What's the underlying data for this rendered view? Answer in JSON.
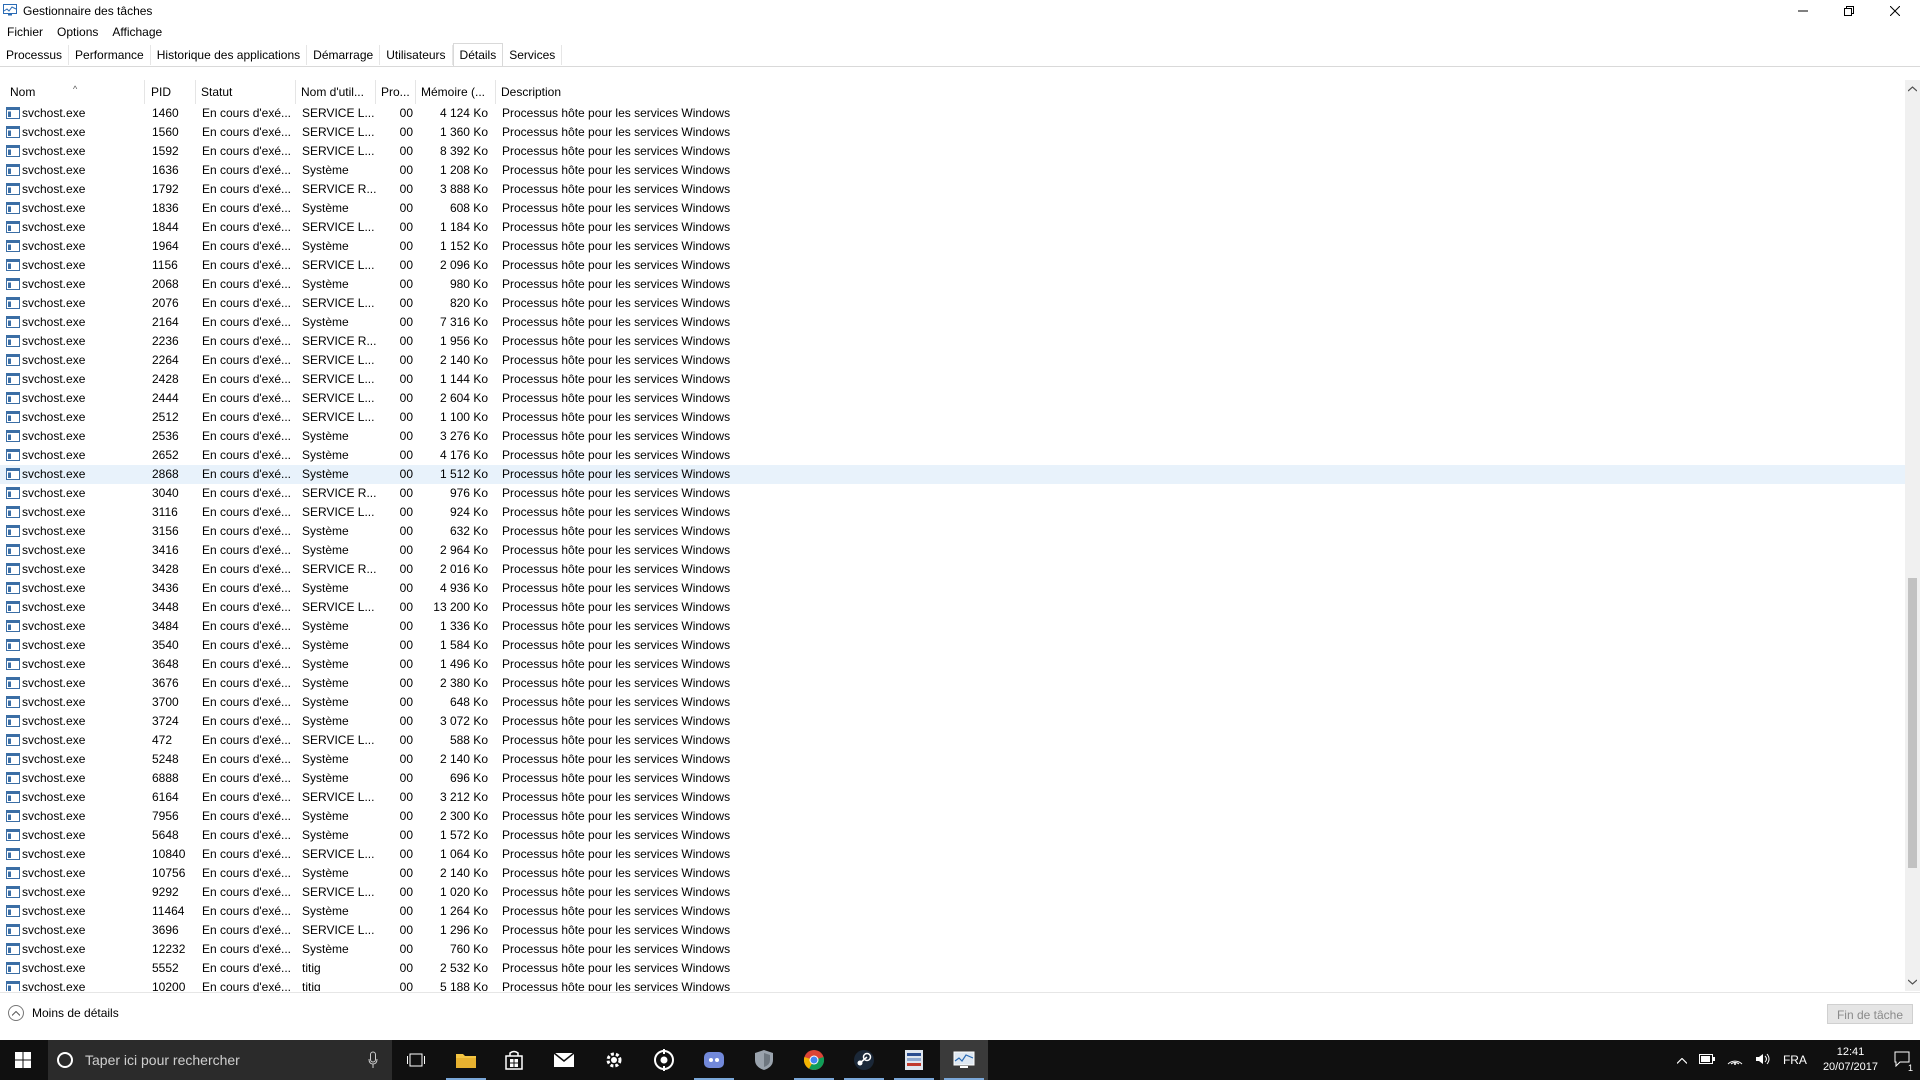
{
  "window": {
    "title": "Gestionnaire des tâches"
  },
  "menu": [
    "Fichier",
    "Options",
    "Affichage"
  ],
  "tabs": [
    {
      "label": "Processus",
      "active": false
    },
    {
      "label": "Performance",
      "active": false
    },
    {
      "label": "Historique des applications",
      "active": false
    },
    {
      "label": "Démarrage",
      "active": false
    },
    {
      "label": "Utilisateurs",
      "active": false
    },
    {
      "label": "Détails",
      "active": true
    },
    {
      "label": "Services",
      "active": false
    }
  ],
  "columns": {
    "name": "Nom",
    "pid": "PID",
    "status": "Statut",
    "user": "Nom d'util...",
    "cpu": "Pro...",
    "memory": "Mémoire (...",
    "description": "Description"
  },
  "selected_pid": "2868",
  "rows": [
    {
      "name": "svchost.exe",
      "pid": "1460",
      "status": "En cours d'exé...",
      "user": "SERVICE L...",
      "cpu": "00",
      "mem": "4 124 Ko",
      "desc": "Processus hôte pour les services Windows"
    },
    {
      "name": "svchost.exe",
      "pid": "1560",
      "status": "En cours d'exé...",
      "user": "SERVICE L...",
      "cpu": "00",
      "mem": "1 360 Ko",
      "desc": "Processus hôte pour les services Windows"
    },
    {
      "name": "svchost.exe",
      "pid": "1592",
      "status": "En cours d'exé...",
      "user": "SERVICE L...",
      "cpu": "00",
      "mem": "8 392 Ko",
      "desc": "Processus hôte pour les services Windows"
    },
    {
      "name": "svchost.exe",
      "pid": "1636",
      "status": "En cours d'exé...",
      "user": "Système",
      "cpu": "00",
      "mem": "1 208 Ko",
      "desc": "Processus hôte pour les services Windows"
    },
    {
      "name": "svchost.exe",
      "pid": "1792",
      "status": "En cours d'exé...",
      "user": "SERVICE R...",
      "cpu": "00",
      "mem": "3 888 Ko",
      "desc": "Processus hôte pour les services Windows"
    },
    {
      "name": "svchost.exe",
      "pid": "1836",
      "status": "En cours d'exé...",
      "user": "Système",
      "cpu": "00",
      "mem": "608 Ko",
      "desc": "Processus hôte pour les services Windows"
    },
    {
      "name": "svchost.exe",
      "pid": "1844",
      "status": "En cours d'exé...",
      "user": "SERVICE L...",
      "cpu": "00",
      "mem": "1 184 Ko",
      "desc": "Processus hôte pour les services Windows"
    },
    {
      "name": "svchost.exe",
      "pid": "1964",
      "status": "En cours d'exé...",
      "user": "Système",
      "cpu": "00",
      "mem": "1 152 Ko",
      "desc": "Processus hôte pour les services Windows"
    },
    {
      "name": "svchost.exe",
      "pid": "1156",
      "status": "En cours d'exé...",
      "user": "SERVICE L...",
      "cpu": "00",
      "mem": "2 096 Ko",
      "desc": "Processus hôte pour les services Windows"
    },
    {
      "name": "svchost.exe",
      "pid": "2068",
      "status": "En cours d'exé...",
      "user": "Système",
      "cpu": "00",
      "mem": "980 Ko",
      "desc": "Processus hôte pour les services Windows"
    },
    {
      "name": "svchost.exe",
      "pid": "2076",
      "status": "En cours d'exé...",
      "user": "SERVICE L...",
      "cpu": "00",
      "mem": "820 Ko",
      "desc": "Processus hôte pour les services Windows"
    },
    {
      "name": "svchost.exe",
      "pid": "2164",
      "status": "En cours d'exé...",
      "user": "Système",
      "cpu": "00",
      "mem": "7 316 Ko",
      "desc": "Processus hôte pour les services Windows"
    },
    {
      "name": "svchost.exe",
      "pid": "2236",
      "status": "En cours d'exé...",
      "user": "SERVICE R...",
      "cpu": "00",
      "mem": "1 956 Ko",
      "desc": "Processus hôte pour les services Windows"
    },
    {
      "name": "svchost.exe",
      "pid": "2264",
      "status": "En cours d'exé...",
      "user": "SERVICE L...",
      "cpu": "00",
      "mem": "2 140 Ko",
      "desc": "Processus hôte pour les services Windows"
    },
    {
      "name": "svchost.exe",
      "pid": "2428",
      "status": "En cours d'exé...",
      "user": "SERVICE L...",
      "cpu": "00",
      "mem": "1 144 Ko",
      "desc": "Processus hôte pour les services Windows"
    },
    {
      "name": "svchost.exe",
      "pid": "2444",
      "status": "En cours d'exé...",
      "user": "SERVICE L...",
      "cpu": "00",
      "mem": "2 604 Ko",
      "desc": "Processus hôte pour les services Windows"
    },
    {
      "name": "svchost.exe",
      "pid": "2512",
      "status": "En cours d'exé...",
      "user": "SERVICE L...",
      "cpu": "00",
      "mem": "1 100 Ko",
      "desc": "Processus hôte pour les services Windows"
    },
    {
      "name": "svchost.exe",
      "pid": "2536",
      "status": "En cours d'exé...",
      "user": "Système",
      "cpu": "00",
      "mem": "3 276 Ko",
      "desc": "Processus hôte pour les services Windows"
    },
    {
      "name": "svchost.exe",
      "pid": "2652",
      "status": "En cours d'exé...",
      "user": "Système",
      "cpu": "00",
      "mem": "4 176 Ko",
      "desc": "Processus hôte pour les services Windows"
    },
    {
      "name": "svchost.exe",
      "pid": "2868",
      "status": "En cours d'exé...",
      "user": "Système",
      "cpu": "00",
      "mem": "1 512 Ko",
      "desc": "Processus hôte pour les services Windows"
    },
    {
      "name": "svchost.exe",
      "pid": "3040",
      "status": "En cours d'exé...",
      "user": "SERVICE R...",
      "cpu": "00",
      "mem": "976 Ko",
      "desc": "Processus hôte pour les services Windows"
    },
    {
      "name": "svchost.exe",
      "pid": "3116",
      "status": "En cours d'exé...",
      "user": "SERVICE L...",
      "cpu": "00",
      "mem": "924 Ko",
      "desc": "Processus hôte pour les services Windows"
    },
    {
      "name": "svchost.exe",
      "pid": "3156",
      "status": "En cours d'exé...",
      "user": "Système",
      "cpu": "00",
      "mem": "632 Ko",
      "desc": "Processus hôte pour les services Windows"
    },
    {
      "name": "svchost.exe",
      "pid": "3416",
      "status": "En cours d'exé...",
      "user": "Système",
      "cpu": "00",
      "mem": "2 964 Ko",
      "desc": "Processus hôte pour les services Windows"
    },
    {
      "name": "svchost.exe",
      "pid": "3428",
      "status": "En cours d'exé...",
      "user": "SERVICE R...",
      "cpu": "00",
      "mem": "2 016 Ko",
      "desc": "Processus hôte pour les services Windows"
    },
    {
      "name": "svchost.exe",
      "pid": "3436",
      "status": "En cours d'exé...",
      "user": "Système",
      "cpu": "00",
      "mem": "4 936 Ko",
      "desc": "Processus hôte pour les services Windows"
    },
    {
      "name": "svchost.exe",
      "pid": "3448",
      "status": "En cours d'exé...",
      "user": "SERVICE L...",
      "cpu": "00",
      "mem": "13 200 Ko",
      "desc": "Processus hôte pour les services Windows"
    },
    {
      "name": "svchost.exe",
      "pid": "3484",
      "status": "En cours d'exé...",
      "user": "Système",
      "cpu": "00",
      "mem": "1 336 Ko",
      "desc": "Processus hôte pour les services Windows"
    },
    {
      "name": "svchost.exe",
      "pid": "3540",
      "status": "En cours d'exé...",
      "user": "Système",
      "cpu": "00",
      "mem": "1 584 Ko",
      "desc": "Processus hôte pour les services Windows"
    },
    {
      "name": "svchost.exe",
      "pid": "3648",
      "status": "En cours d'exé...",
      "user": "Système",
      "cpu": "00",
      "mem": "1 496 Ko",
      "desc": "Processus hôte pour les services Windows"
    },
    {
      "name": "svchost.exe",
      "pid": "3676",
      "status": "En cours d'exé...",
      "user": "Système",
      "cpu": "00",
      "mem": "2 380 Ko",
      "desc": "Processus hôte pour les services Windows"
    },
    {
      "name": "svchost.exe",
      "pid": "3700",
      "status": "En cours d'exé...",
      "user": "Système",
      "cpu": "00",
      "mem": "648 Ko",
      "desc": "Processus hôte pour les services Windows"
    },
    {
      "name": "svchost.exe",
      "pid": "3724",
      "status": "En cours d'exé...",
      "user": "Système",
      "cpu": "00",
      "mem": "3 072 Ko",
      "desc": "Processus hôte pour les services Windows"
    },
    {
      "name": "svchost.exe",
      "pid": "472",
      "status": "En cours d'exé...",
      "user": "SERVICE L...",
      "cpu": "00",
      "mem": "588 Ko",
      "desc": "Processus hôte pour les services Windows"
    },
    {
      "name": "svchost.exe",
      "pid": "5248",
      "status": "En cours d'exé...",
      "user": "Système",
      "cpu": "00",
      "mem": "2 140 Ko",
      "desc": "Processus hôte pour les services Windows"
    },
    {
      "name": "svchost.exe",
      "pid": "6888",
      "status": "En cours d'exé...",
      "user": "Système",
      "cpu": "00",
      "mem": "696 Ko",
      "desc": "Processus hôte pour les services Windows"
    },
    {
      "name": "svchost.exe",
      "pid": "6164",
      "status": "En cours d'exé...",
      "user": "SERVICE L...",
      "cpu": "00",
      "mem": "3 212 Ko",
      "desc": "Processus hôte pour les services Windows"
    },
    {
      "name": "svchost.exe",
      "pid": "7956",
      "status": "En cours d'exé...",
      "user": "Système",
      "cpu": "00",
      "mem": "2 300 Ko",
      "desc": "Processus hôte pour les services Windows"
    },
    {
      "name": "svchost.exe",
      "pid": "5648",
      "status": "En cours d'exé...",
      "user": "Système",
      "cpu": "00",
      "mem": "1 572 Ko",
      "desc": "Processus hôte pour les services Windows"
    },
    {
      "name": "svchost.exe",
      "pid": "10840",
      "status": "En cours d'exé...",
      "user": "SERVICE L...",
      "cpu": "00",
      "mem": "1 064 Ko",
      "desc": "Processus hôte pour les services Windows"
    },
    {
      "name": "svchost.exe",
      "pid": "10756",
      "status": "En cours d'exé...",
      "user": "Système",
      "cpu": "00",
      "mem": "2 140 Ko",
      "desc": "Processus hôte pour les services Windows"
    },
    {
      "name": "svchost.exe",
      "pid": "9292",
      "status": "En cours d'exé...",
      "user": "SERVICE L...",
      "cpu": "00",
      "mem": "1 020 Ko",
      "desc": "Processus hôte pour les services Windows"
    },
    {
      "name": "svchost.exe",
      "pid": "11464",
      "status": "En cours d'exé...",
      "user": "Système",
      "cpu": "00",
      "mem": "1 264 Ko",
      "desc": "Processus hôte pour les services Windows"
    },
    {
      "name": "svchost.exe",
      "pid": "3696",
      "status": "En cours d'exé...",
      "user": "SERVICE L...",
      "cpu": "00",
      "mem": "1 296 Ko",
      "desc": "Processus hôte pour les services Windows"
    },
    {
      "name": "svchost.exe",
      "pid": "12232",
      "status": "En cours d'exé...",
      "user": "Système",
      "cpu": "00",
      "mem": "760 Ko",
      "desc": "Processus hôte pour les services Windows"
    },
    {
      "name": "svchost.exe",
      "pid": "5552",
      "status": "En cours d'exé...",
      "user": "titig",
      "cpu": "00",
      "mem": "2 532 Ko",
      "desc": "Processus hôte pour les services Windows"
    },
    {
      "name": "svchost.exe",
      "pid": "10200",
      "status": "En cours d'exé...",
      "user": "titig",
      "cpu": "00",
      "mem": "5 188 Ko",
      "desc": "Processus hôte pour les services Windows"
    }
  ],
  "footer": {
    "less_details": "Moins de détails",
    "end_task": "Fin de tâche"
  },
  "taskbar": {
    "search_placeholder": "Taper ici pour rechercher",
    "language": "FRA",
    "time": "12:41",
    "date": "20/07/2017",
    "notification_count": "1",
    "pinned": [
      "task-view",
      "file-explorer",
      "store",
      "mail",
      "settings",
      "steam-client",
      "discord",
      "cortana-app",
      "chrome",
      "steam",
      "media-app",
      "task-manager"
    ]
  }
}
